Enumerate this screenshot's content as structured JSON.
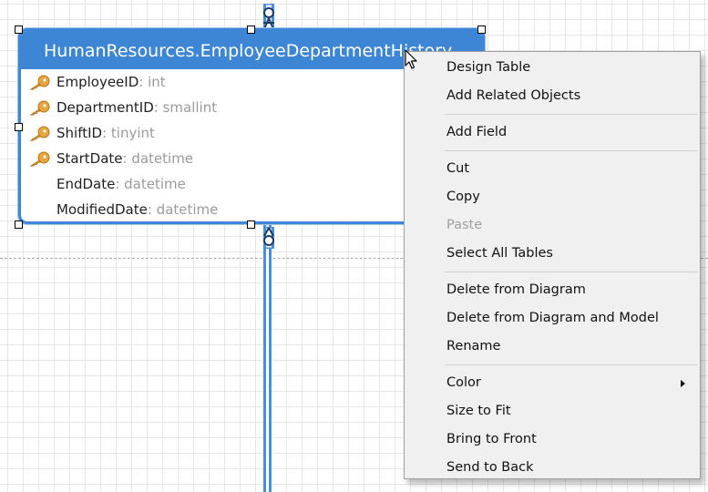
{
  "entity": {
    "title": "HumanResources.EmployeeDepartmentHistory",
    "fields": [
      {
        "name": "EmployeeID",
        "type": ": int",
        "primary_key": true
      },
      {
        "name": "DepartmentID",
        "type": ": smallint",
        "primary_key": true
      },
      {
        "name": "ShiftID",
        "type": ": tinyint",
        "primary_key": true
      },
      {
        "name": "StartDate",
        "type": ": datetime",
        "primary_key": true
      },
      {
        "name": "EndDate",
        "type": ": datetime",
        "primary_key": false
      },
      {
        "name": "ModifiedDate",
        "type": ": datetime",
        "primary_key": false
      }
    ]
  },
  "context_menu": {
    "design_table": "Design Table",
    "add_related_objects": "Add Related Objects",
    "add_field": "Add Field",
    "cut": "Cut",
    "copy": "Copy",
    "paste": "Paste",
    "select_all_tables": "Select All Tables",
    "delete_from_diagram": "Delete from Diagram",
    "delete_from_diagram_and_model": "Delete from Diagram and Model",
    "rename": "Rename",
    "color": "Color",
    "size_to_fit": "Size to Fit",
    "bring_to_front": "Bring to Front",
    "send_to_back": "Send to Back"
  },
  "colors": {
    "header": "#3d86d6",
    "border": "#3f86d6",
    "key": "#e9a53c",
    "field_type": "#9a9a9a",
    "menu_bg": "#f0f0f0"
  },
  "icons": {
    "key": "key-icon",
    "cursor": "mouse-pointer-icon",
    "submenu": "chevron-right-icon",
    "connector": "relationship-connector-icon"
  }
}
